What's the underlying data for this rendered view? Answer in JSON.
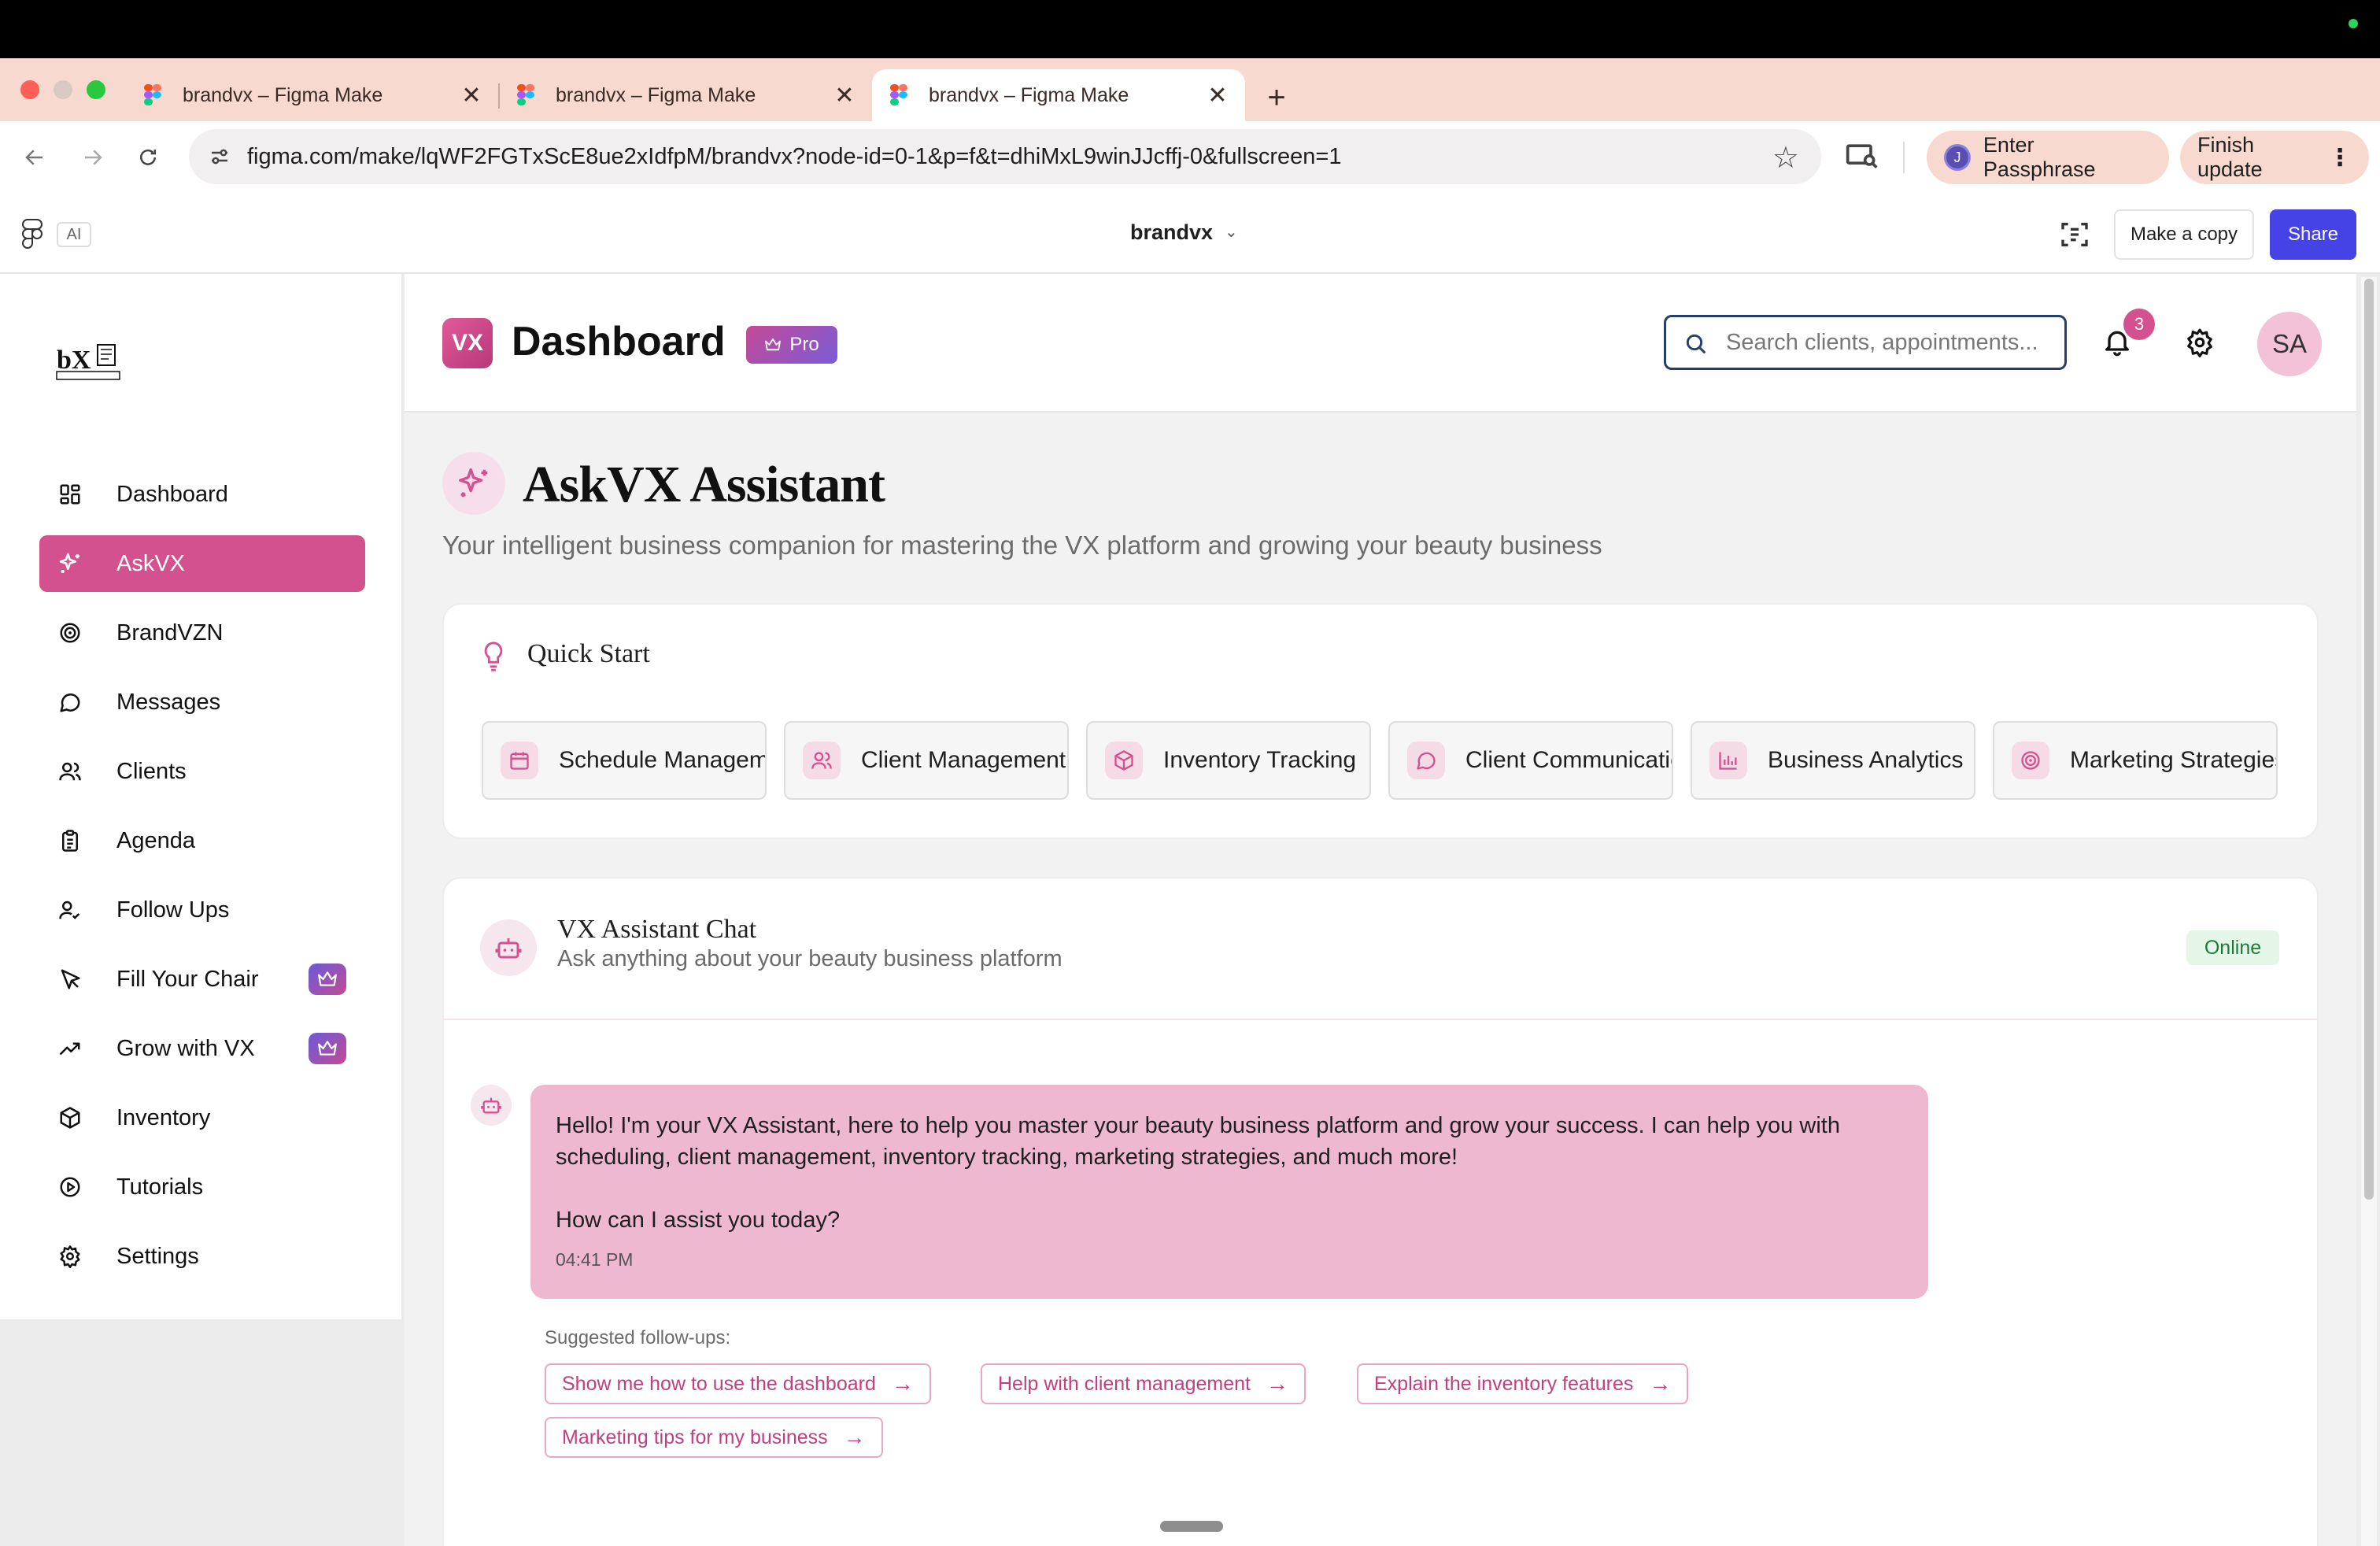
{
  "browser": {
    "tabs": [
      {
        "title": "brandvx – Figma Make",
        "active": false
      },
      {
        "title": "brandvx – Figma Make",
        "active": false
      },
      {
        "title": "brandvx – Figma Make",
        "active": true
      }
    ],
    "new_tab": "+",
    "close_glyph": "✕",
    "url": "figma.com/make/lqWF2FGTxScE8ue2xIdfpM/brandvx?node-id=0-1&p=f&t=dhiMxL9winJJcffj-0&fullscreen=1",
    "profile_initial": "J",
    "enter_passphrase": "Enter Passphrase",
    "finish_update": "Finish update"
  },
  "figma": {
    "ai_badge": "AI",
    "project_name": "brandvx",
    "make_copy": "Make a copy",
    "share": "Share"
  },
  "sidebar": {
    "items": [
      {
        "label": "Dashboard",
        "icon": "grid-icon",
        "active": false,
        "pro": false
      },
      {
        "label": "AskVX",
        "icon": "sparkles-icon",
        "active": true,
        "pro": false
      },
      {
        "label": "BrandVZN",
        "icon": "target-icon",
        "active": false,
        "pro": false
      },
      {
        "label": "Messages",
        "icon": "message-icon",
        "active": false,
        "pro": false
      },
      {
        "label": "Clients",
        "icon": "users-icon",
        "active": false,
        "pro": false
      },
      {
        "label": "Agenda",
        "icon": "clipboard-icon",
        "active": false,
        "pro": false
      },
      {
        "label": "Follow Ups",
        "icon": "user-check-icon",
        "active": false,
        "pro": false
      },
      {
        "label": "Fill Your Chair",
        "icon": "cursor-icon",
        "active": false,
        "pro": true
      },
      {
        "label": "Grow with VX",
        "icon": "trending-up-icon",
        "active": false,
        "pro": true
      },
      {
        "label": "Inventory",
        "icon": "box-icon",
        "active": false,
        "pro": false
      },
      {
        "label": "Tutorials",
        "icon": "play-icon",
        "active": false,
        "pro": false
      },
      {
        "label": "Settings",
        "icon": "gear-icon",
        "active": false,
        "pro": false
      }
    ]
  },
  "header": {
    "logo_text": "VX",
    "title": "Dashboard",
    "badge": "Pro",
    "search_placeholder": "Search clients, appointments...",
    "notifications_count": "3",
    "avatar_initials": "SA"
  },
  "page": {
    "title": "AskVX Assistant",
    "subtitle": "Your intelligent business companion for mastering the VX platform and growing your beauty business"
  },
  "quick_start": {
    "title": "Quick Start",
    "chips": [
      {
        "label": "Schedule Management",
        "icon": "calendar-icon"
      },
      {
        "label": "Client Management",
        "icon": "users-icon"
      },
      {
        "label": "Inventory Tracking",
        "icon": "box-icon"
      },
      {
        "label": "Client Communication",
        "icon": "message-icon"
      },
      {
        "label": "Business Analytics",
        "icon": "bar-chart-icon"
      },
      {
        "label": "Marketing Strategies",
        "icon": "target-icon"
      }
    ]
  },
  "chat": {
    "title": "VX Assistant Chat",
    "subtitle": "Ask anything about your beauty business platform",
    "status": "Online",
    "message_line1": "Hello! I'm your VX Assistant, here to help you master your beauty business platform and grow your success. I can help you with scheduling, client management, inventory tracking, marketing strategies, and much more!",
    "message_line2": "How can I assist you today?",
    "message_time": "04:41 PM",
    "suggestions_label": "Suggested follow-ups:",
    "suggestions": [
      "Show me how to use the dashboard",
      "Help with client management",
      "Explain the inventory features",
      "Marketing tips for my business"
    ]
  },
  "colors": {
    "accent": "#d4518f",
    "bubble": "#efb8d1",
    "share_button": "#4543e6",
    "chrome": "#f8d9cf"
  }
}
